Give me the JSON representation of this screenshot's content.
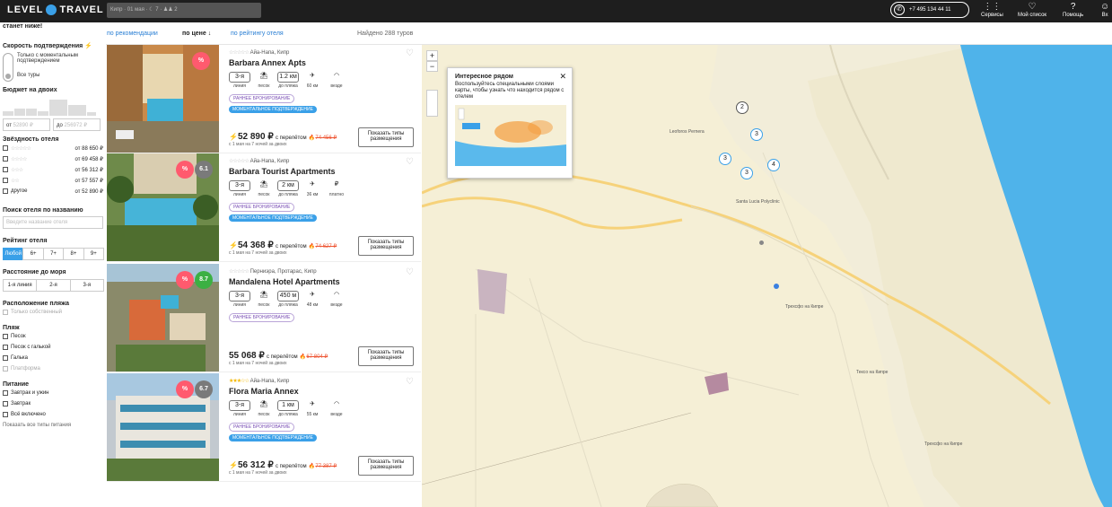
{
  "header": {
    "logo_left": "LEVEL",
    "logo_right": "TRAVEL",
    "search_text": "Кипр · 01 мая · ☾ 7 · ♟♟ 2",
    "phone": "+7 495 134 44 11",
    "nav": [
      {
        "label": "Сервисы",
        "icon": "grid-icon",
        "glyph": "⋮⋮"
      },
      {
        "label": "Мой список",
        "icon": "heart-icon",
        "glyph": "♡"
      },
      {
        "label": "Помощь",
        "icon": "help-icon",
        "glyph": "?"
      },
      {
        "label": "Вх",
        "icon": "user-icon",
        "glyph": "☺"
      }
    ]
  },
  "sort": {
    "by_recommendation": "по рекомендации",
    "by_price": "по цене ↓",
    "by_rating": "по рейтингу отеля",
    "found": "Найдено 288 туров"
  },
  "filters": {
    "banner": "станет ниже!",
    "speed_title": "Скорость подтверждения",
    "speed_opt1": "Только с моментальным подтверждением",
    "speed_opt2": "Все туры",
    "budget_title": "Бюджет на двоих",
    "budget_from_label": "от",
    "budget_from": "52890 ₽",
    "budget_to_label": "до",
    "budget_to": "256972 ₽",
    "stars_title": "Звёздность отеля",
    "stars": [
      {
        "stars": "☆☆☆☆☆",
        "price": "от 88 650 ₽"
      },
      {
        "stars": "☆☆☆☆",
        "price": "от 69 458 ₽"
      },
      {
        "stars": "☆☆☆",
        "price": "от 56 312 ₽"
      },
      {
        "stars": "☆☆",
        "price": "от 57 557 ₽"
      },
      {
        "stars": "другое",
        "price": "от 52 890 ₽"
      }
    ],
    "hotel_search_title": "Поиск отеля по названию",
    "hotel_search_placeholder": "Введите название отеля",
    "rating_title": "Рейтинг отеля",
    "rating_opts": [
      "Любой",
      "6+",
      "7+",
      "8+",
      "9+"
    ],
    "sea_title": "Расстояние до моря",
    "sea_opts": [
      "1-я линия",
      "2-я",
      "3-я"
    ],
    "beach_loc_title": "Расположение пляжа",
    "beach_loc_opt": "Только собственный",
    "beach_title": "Пляж",
    "beach_opts": [
      "Песок",
      "Песок с галькой",
      "Галька",
      "Платформа"
    ],
    "food_title": "Питание",
    "food_opts": [
      "Завтрак и ужин",
      "Завтрак",
      "Всё включено"
    ],
    "show_all": "Показать все типы питания"
  },
  "hotels": [
    {
      "stars": "☆☆☆☆☆",
      "location": "Айа-Напа, Кипр",
      "name": "Barbara Annex Apts",
      "line": "3-я",
      "line_label": "линия",
      "beach": "песок",
      "dist": "1.2 км",
      "dist_label": "до пляжа",
      "flight": "60 км",
      "wifi": "везде",
      "early": "РАННЕЕ БРОНИРОВАНИЕ",
      "instant": "МОМЕНТАЛЬНОЕ ПОДТВЕРЖДЕНИЕ",
      "price": "52 890 ₽",
      "transfer": "с перелётом",
      "old_price": "74 456 ₽",
      "dates": "с 1 мая на 7 ночей за двоих",
      "rating": "%",
      "button": "Показать типы размещения"
    },
    {
      "stars": "☆☆☆☆☆",
      "location": "Айа-Напа, Кипр",
      "name": "Barbara Tourist Apartments",
      "line": "3-я",
      "line_label": "линия",
      "beach": "песок",
      "dist": "2 км",
      "dist_label": "до пляжа",
      "flight": "36 км",
      "wifi": "платно",
      "early": "РАННЕЕ БРОНИРОВАНИЕ",
      "instant": "МОМЕНТАЛЬНОЕ ПОДТВЕРЖДЕНИЕ",
      "price": "54 368 ₽",
      "transfer": "с перелётом",
      "old_price": "74 627 ₽",
      "dates": "с 1 мая на 7 ночей за двоих",
      "rating": "6.1",
      "button": "Показать типы размещения"
    },
    {
      "stars": "☆☆☆☆☆",
      "location": "Перниэра, Протарас, Кипр",
      "name": "Mandalena Hotel Apartments",
      "line": "3-я",
      "line_label": "линия",
      "beach": "песок",
      "dist": "450 м",
      "dist_label": "до пляжа",
      "flight": "48 км",
      "wifi": "везде",
      "early": "РАННЕЕ БРОНИРОВАНИЕ",
      "instant": "",
      "price": "55 068 ₽",
      "transfer": "с перелётом",
      "old_price": "67 804 ₽",
      "dates": "с 1 мая на 7 ночей за двоих",
      "rating": "8.7",
      "button": "Показать типы размещения"
    },
    {
      "stars": "★★★☆☆",
      "location": "Айа-Напа, Кипр",
      "name": "Flora Maria Annex",
      "line": "3-я",
      "line_label": "линия",
      "beach": "песок",
      "dist": "1 км",
      "dist_label": "до пляжа",
      "flight": "55 км",
      "wifi": "везде",
      "early": "РАННЕЕ БРОНИРОВАНИЕ",
      "instant": "МОМЕНТАЛЬНОЕ ПОДТВЕРЖДЕНИЕ",
      "price": "56 312 ₽",
      "transfer": "с перелётом",
      "old_price": "77 387 ₽",
      "dates": "с 1 мая на 7 ночей за двоих",
      "rating": "6.7",
      "button": "Показать типы размещения"
    }
  ],
  "map": {
    "popup_title": "Интересное рядом",
    "popup_text": "Воспользуйтесь специальными слоями карты, чтобы узнать что находится рядом с отелем",
    "zoom_in": "+",
    "zoom_out": "−",
    "labels": [
      "Трехсфо на Кипре",
      "Трехсфо на Кипре",
      "Тексо на Кипре",
      "Leoforos Pernera",
      "Santa Lucia Polyclinic"
    ],
    "clusters": [
      "2",
      "3",
      "3",
      "3",
      "4"
    ]
  }
}
